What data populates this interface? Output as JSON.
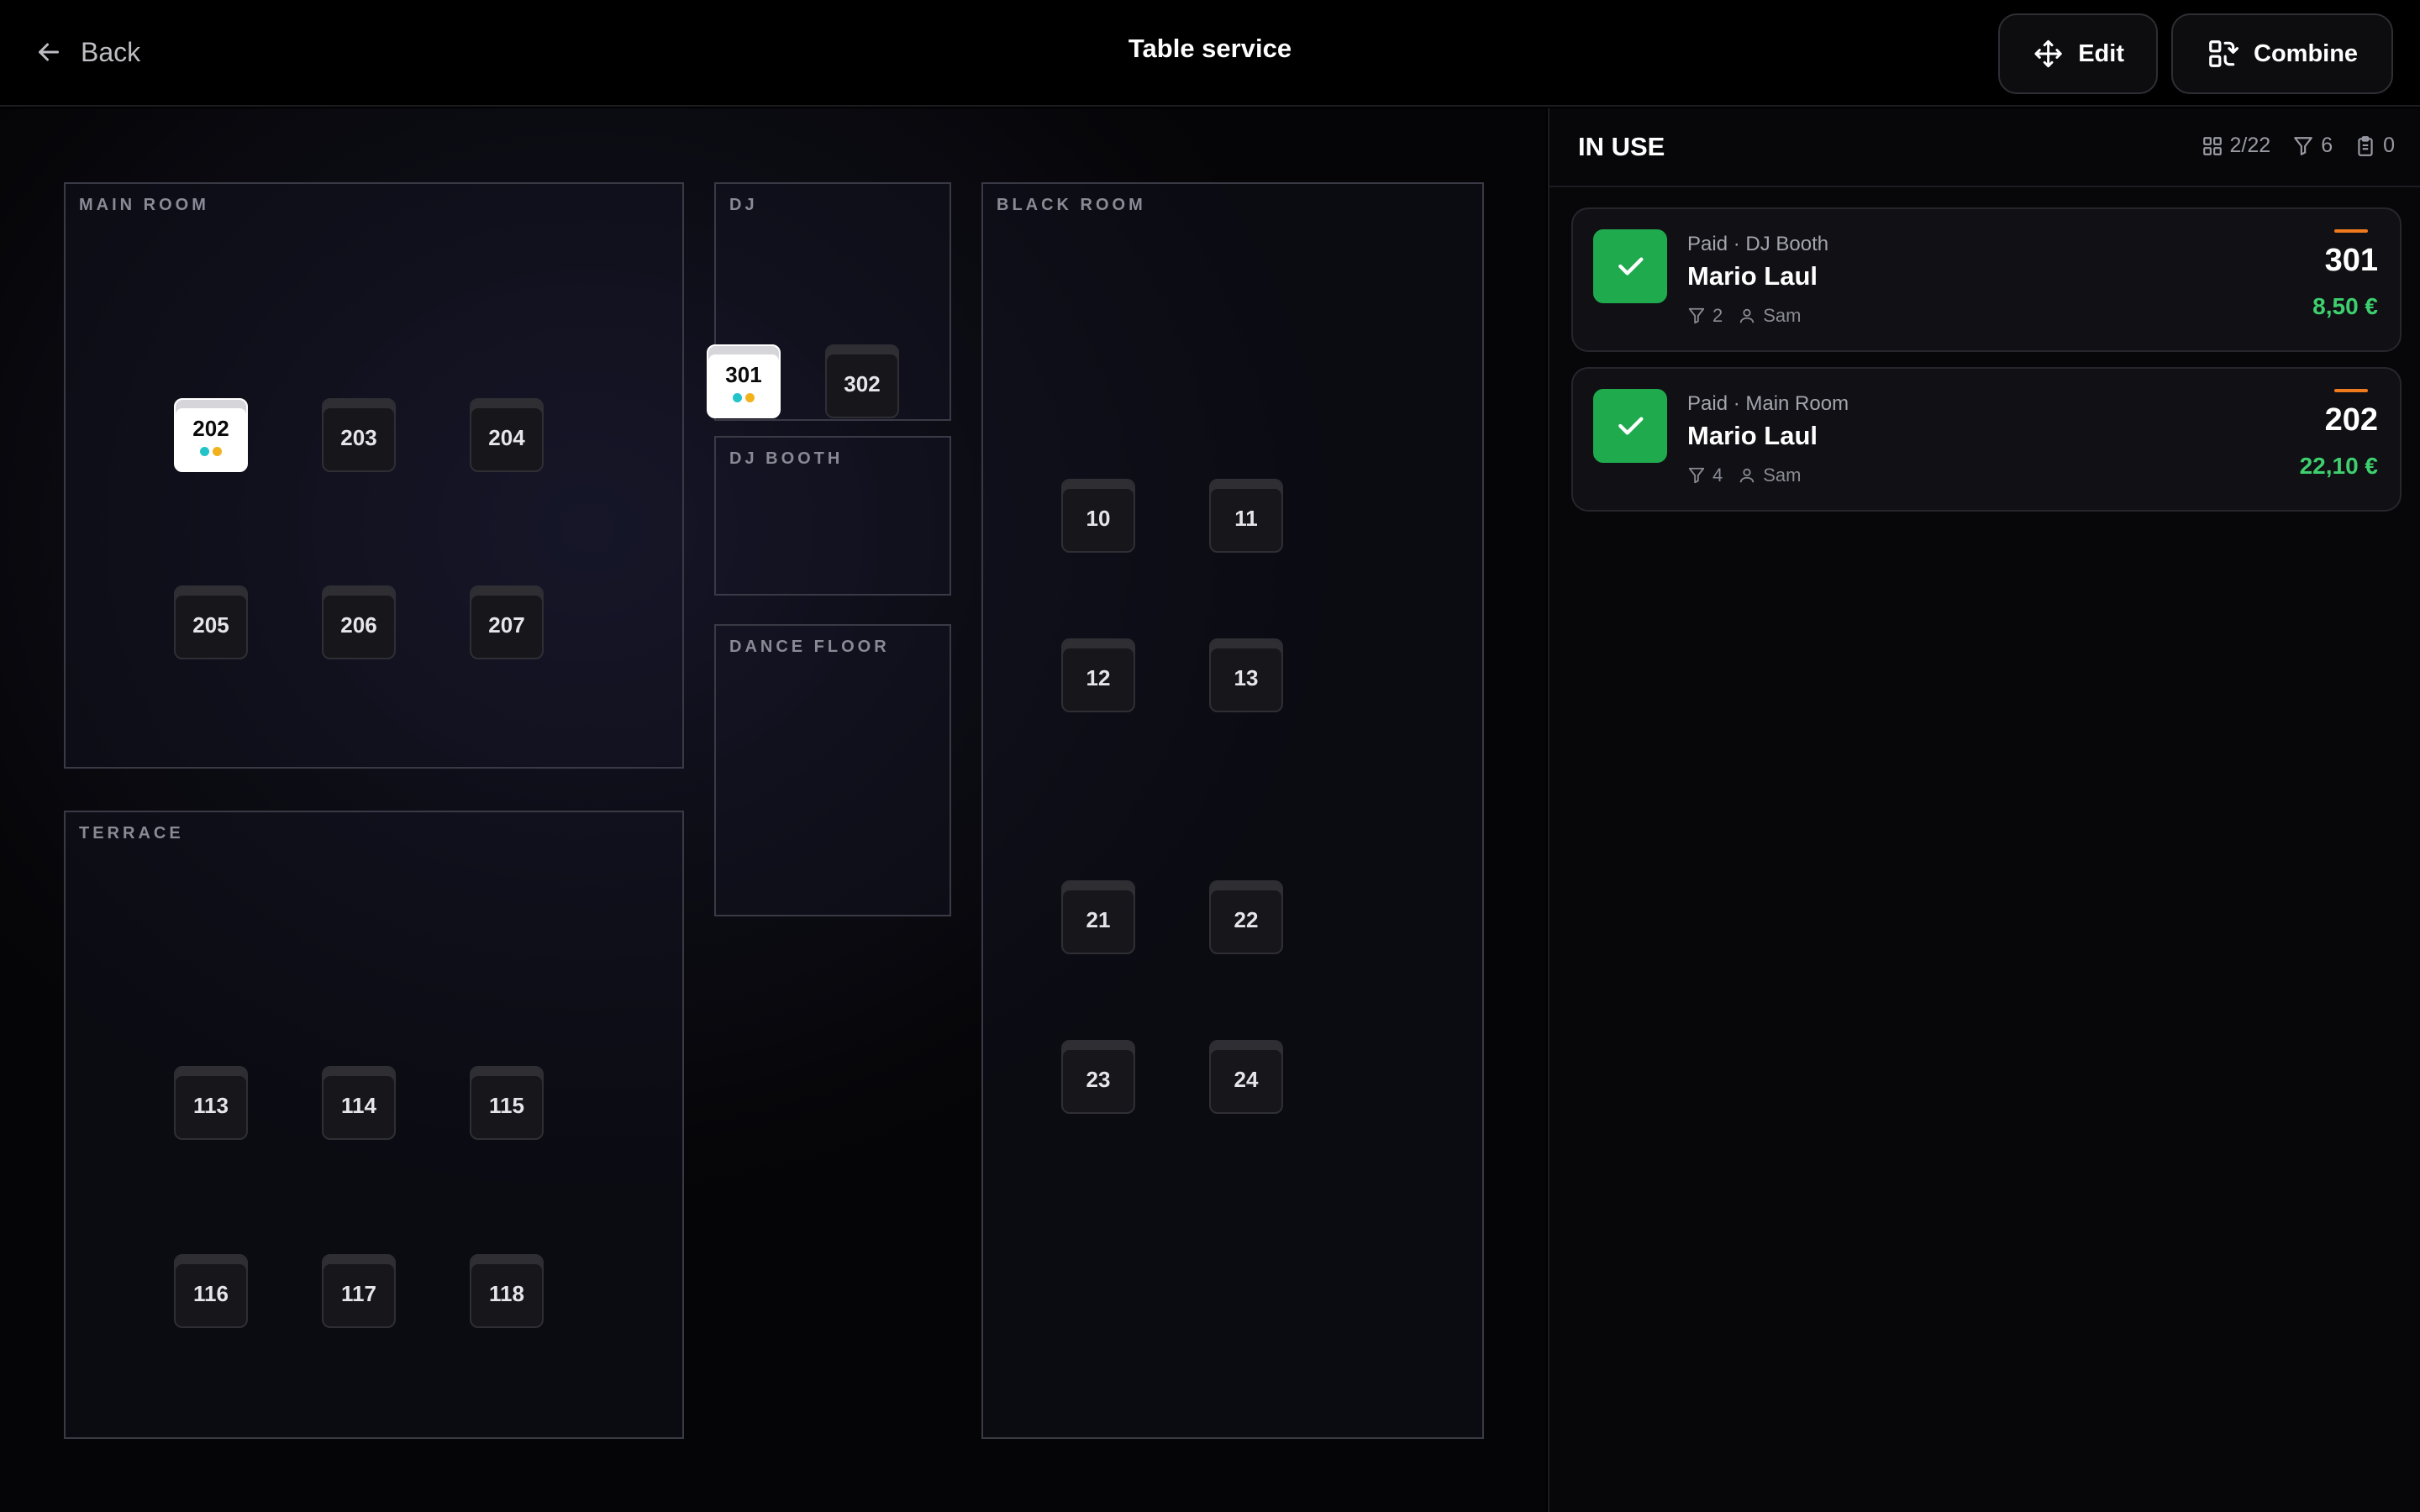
{
  "header": {
    "back_label": "Back",
    "title": "Table service",
    "edit_label": "Edit",
    "combine_label": "Combine"
  },
  "rooms": {
    "main_room": "MAIN ROOM",
    "dj": "DJ",
    "dj_booth": "DJ BOOTH",
    "dance_floor": "DANCE FLOOR",
    "black_room": "BLACK ROOM",
    "terrace": "TERRACE"
  },
  "tables": {
    "t202": "202",
    "t203": "203",
    "t204": "204",
    "t205": "205",
    "t206": "206",
    "t207": "207",
    "t301": "301",
    "t302": "302",
    "t10": "10",
    "t11": "11",
    "t12": "12",
    "t13": "13",
    "t21": "21",
    "t22": "22",
    "t23": "23",
    "t24": "24",
    "t113": "113",
    "t114": "114",
    "t115": "115",
    "t116": "116",
    "t117": "117",
    "t118": "118"
  },
  "active_tables": [
    "202",
    "301"
  ],
  "indicator_colors": {
    "teal": "#22c3c9",
    "amber": "#f2b21c"
  },
  "panel": {
    "title": "IN USE",
    "stats": {
      "tables": "2/22",
      "guests": "6",
      "orders": "0"
    }
  },
  "orders": [
    {
      "status": "Paid · DJ Booth",
      "name": "Mario Laul",
      "guests": "2",
      "waiter": "Sam",
      "table": "301",
      "amount": "8,50 €"
    },
    {
      "status": "Paid · Main Room",
      "name": "Mario Laul",
      "guests": "4",
      "waiter": "Sam",
      "table": "202",
      "amount": "22,10 €"
    }
  ],
  "colors": {
    "paid_green": "#1faa4e",
    "amount_green": "#3ecf6e",
    "accent_orange": "#f07a1e"
  }
}
